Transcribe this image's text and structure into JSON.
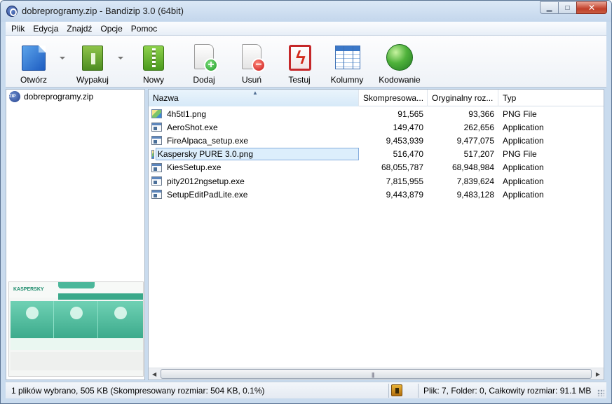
{
  "window": {
    "title": "dobreprogramy.zip - Bandizip 3.0 (64bit)"
  },
  "menu": [
    "Plik",
    "Edycja",
    "Znajdź",
    "Opcje",
    "Pomoc"
  ],
  "toolbar": {
    "open": "Otwórz",
    "extract": "Wypakuj",
    "new": "Nowy",
    "add": "Dodaj",
    "delete": "Usuń",
    "test": "Testuj",
    "columns": "Kolumny",
    "encoding": "Kodowanie"
  },
  "tree": {
    "root": "dobreprogramy.zip"
  },
  "columns": {
    "name": "Nazwa",
    "compressed": "Skompresowa...",
    "original": "Oryginalny roz...",
    "type": "Typ"
  },
  "files": [
    {
      "name": "4h5tl1.png",
      "compressed": "91,565",
      "original": "93,366",
      "type": "PNG File",
      "icon": "png-file-icon"
    },
    {
      "name": "AeroShot.exe",
      "compressed": "149,470",
      "original": "262,656",
      "type": "Application",
      "icon": "exe-file-icon"
    },
    {
      "name": "FireAlpaca_setup.exe",
      "compressed": "9,453,939",
      "original": "9,477,075",
      "type": "Application",
      "icon": "exe-file-icon"
    },
    {
      "name": "Kaspersky PURE 3.0.png",
      "compressed": "516,470",
      "original": "517,207",
      "type": "PNG File",
      "icon": "png-file-icon",
      "selected": true
    },
    {
      "name": "KiesSetup.exe",
      "compressed": "68,055,787",
      "original": "68,948,984",
      "type": "Application",
      "icon": "exe-file-icon"
    },
    {
      "name": "pity2012ngsetup.exe",
      "compressed": "7,815,955",
      "original": "7,839,624",
      "type": "Application",
      "icon": "exe-file-icon"
    },
    {
      "name": "SetupEditPadLite.exe",
      "compressed": "9,443,879",
      "original": "9,483,128",
      "type": "Application",
      "icon": "exe-file-icon"
    }
  ],
  "status": {
    "left": "1 plików wybrano, 505 KB (Skompresowany rozmiar: 504 KB, 0.1%)",
    "right": "Plik: 7, Folder: 0, Całkowity rozmiar: 91.1 MB"
  },
  "colors": {
    "selection": "#dceefc",
    "selection_border": "#84acdd",
    "chrome": "#c9dbee"
  }
}
